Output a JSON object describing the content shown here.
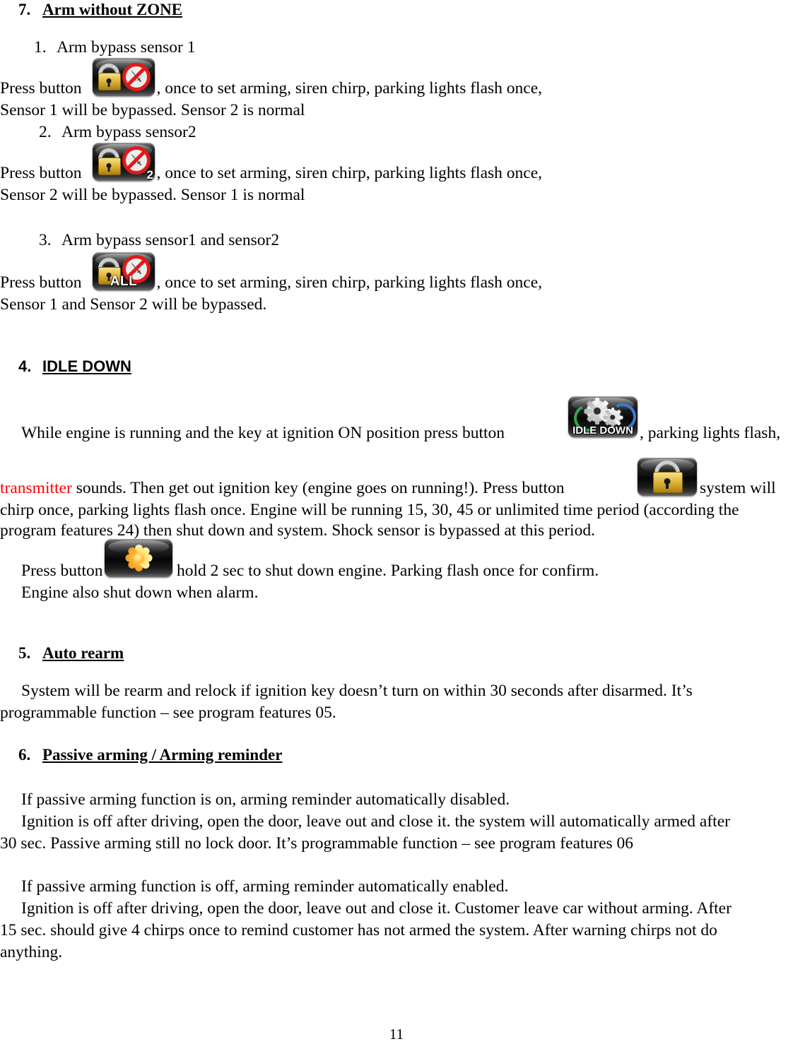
{
  "document": {
    "page_number": "11"
  },
  "sections": {
    "arm_without_zone": {
      "number": "7.",
      "title": "Arm without ZONE",
      "items": [
        {
          "number": "1.",
          "label": "Arm bypass sensor 1",
          "press_prefix": "Press button",
          "press_suffix": ",  once to set arming, siren chirp, parking lights flash once,",
          "detail": "Sensor 1 will be bypassed. Sensor 2 is normal",
          "icon": "lock-bypass-sensor1-icon",
          "icon_badge": ""
        },
        {
          "number": "2.",
          "label": "Arm bypass sensor2",
          "press_prefix": "Press button",
          "press_suffix": ",  once to set arming, siren chirp, parking lights flash once,",
          "detail": "Sensor  2 will be bypassed. Sensor 1 is normal",
          "icon": "lock-bypass-sensor2-icon",
          "icon_badge": "2"
        },
        {
          "number": "3.",
          "label": "Arm bypass sensor1 and sensor2",
          "press_prefix": "Press button",
          "press_suffix": ",  once to set arming, siren chirp, parking lights flash once,",
          "detail": "Sensor  1 and Sensor 2 will be bypassed.",
          "icon": "lock-bypass-all-icon",
          "icon_badge": "ALL"
        }
      ]
    },
    "idle_down": {
      "number": "4.",
      "title": "IDLE DOWN",
      "idle_button_label": "IDLE DOWN",
      "line1_a": "While  engine  is  running  and  the  key  at  ignition  ON  position  press  button",
      "line1_b": ",  parking  lights  flash,",
      "line2_red": "transmitter",
      "line2_a": "sounds.  Then  get  out  ignition  key  (engine  goes  on  running!).  Press  button",
      "line2_b": "system  will",
      "line3": "chirp once, parking lights flash once. Engine will be running 15, 30, 45 or unlimited time period (according the",
      "line4": "program features 24) then shut down and system. Shock sensor is bypassed at this period.",
      "line5_a": "Press button",
      "line5_b": "hold 2 sec to shut down engine. Parking flash once for confirm.",
      "line6": "Engine also shut down when alarm."
    },
    "auto_rearm": {
      "number": "5.",
      "title": "Auto rearm",
      "line1": "System will be rearm and relock if ignition key doesn’t turn on within 30 seconds after disarmed. It’s",
      "line2": "programmable function – see program features 05."
    },
    "passive_arming": {
      "number": "6.",
      "title": "Passive arming / Arming reminder",
      "p1_line1": "If passive arming function is on, arming reminder automatically disabled.",
      "p1_line2": "Ignition is off after driving, open the door, leave out and close it. the system will automatically armed after",
      "p1_line3": "30 sec. Passive arming still no lock door. It’s programmable function – see program features 06",
      "p2_line1": "If passive arming function is off, arming reminder automatically enabled.",
      "p2_line2": "Ignition is off after driving, open the door, leave out and close it. Customer leave car without arming. After",
      "p2_line3": "15 sec. should give 4 chirps once to remind customer has not armed the system. After warning chirps not do",
      "p2_line4": "anything."
    }
  },
  "colors": {
    "red_text": "#ff0000",
    "body_text": "#000000",
    "lock_gold": "#e8c04a",
    "prohibition_red": "#e01a1a"
  }
}
